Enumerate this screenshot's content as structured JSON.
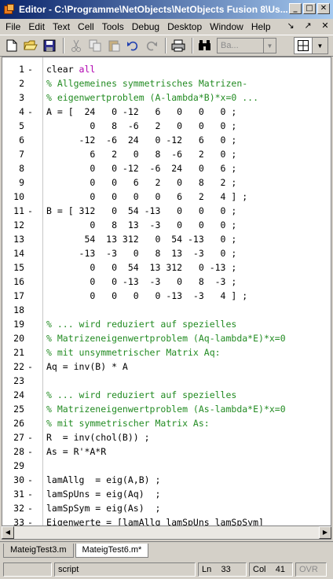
{
  "window": {
    "title": "Editor - C:\\Programme\\NetObjects\\NetObjects Fusion 8\\Us...",
    "buttons": [
      "_",
      "□",
      "✕"
    ]
  },
  "menu": {
    "items": [
      "File",
      "Edit",
      "Text",
      "Cell",
      "Tools",
      "Debug",
      "Desktop",
      "Window",
      "Help"
    ],
    "right_icons": [
      "↘",
      "↗",
      "✕"
    ]
  },
  "toolbar": {
    "combo_value": "Ba...",
    "icons": [
      "new-file-icon",
      "open-folder-icon",
      "save-icon",
      "cut-icon",
      "copy-icon",
      "paste-icon",
      "undo-icon",
      "redo-icon",
      "print-icon",
      "find-icon"
    ]
  },
  "editor": {
    "lines": [
      {
        "n": "1",
        "dash": "-",
        "segments": [
          {
            "t": "clear ",
            "c": ""
          },
          {
            "t": "all",
            "c": "kw"
          }
        ]
      },
      {
        "n": "2",
        "dash": "",
        "segments": [
          {
            "t": "% Allgemeines symmetrisches Matrizen-",
            "c": "cm"
          }
        ]
      },
      {
        "n": "3",
        "dash": "",
        "segments": [
          {
            "t": "% eigenwertproblem (A-lambda*B)*x=0 ...",
            "c": "cm"
          }
        ]
      },
      {
        "n": "4",
        "dash": "-",
        "segments": [
          {
            "t": "A = [  24   0 -12   6   0   0   0 ;",
            "c": ""
          }
        ]
      },
      {
        "n": "5",
        "dash": "",
        "segments": [
          {
            "t": "        0   8  -6   2   0   0   0 ;",
            "c": ""
          }
        ]
      },
      {
        "n": "6",
        "dash": "",
        "segments": [
          {
            "t": "      -12  -6  24   0 -12   6   0 ;",
            "c": ""
          }
        ]
      },
      {
        "n": "7",
        "dash": "",
        "segments": [
          {
            "t": "        6   2   0   8  -6   2   0 ;",
            "c": ""
          }
        ]
      },
      {
        "n": "8",
        "dash": "",
        "segments": [
          {
            "t": "        0   0 -12  -6  24   0   6 ;",
            "c": ""
          }
        ]
      },
      {
        "n": "9",
        "dash": "",
        "segments": [
          {
            "t": "        0   0   6   2   0   8   2 ;",
            "c": ""
          }
        ]
      },
      {
        "n": "10",
        "dash": "",
        "segments": [
          {
            "t": "        0   0   0   0   6   2   4 ] ;",
            "c": ""
          }
        ]
      },
      {
        "n": "11",
        "dash": "-",
        "segments": [
          {
            "t": "B = [ 312   0  54 -13   0   0   0 ;",
            "c": ""
          }
        ]
      },
      {
        "n": "12",
        "dash": "",
        "segments": [
          {
            "t": "        0   8  13  -3   0   0   0 ;",
            "c": ""
          }
        ]
      },
      {
        "n": "13",
        "dash": "",
        "segments": [
          {
            "t": "       54  13 312   0  54 -13   0 ;",
            "c": ""
          }
        ]
      },
      {
        "n": "14",
        "dash": "",
        "segments": [
          {
            "t": "      -13  -3   0   8  13  -3   0 ;",
            "c": ""
          }
        ]
      },
      {
        "n": "15",
        "dash": "",
        "segments": [
          {
            "t": "        0   0  54  13 312   0 -13 ;",
            "c": ""
          }
        ]
      },
      {
        "n": "16",
        "dash": "",
        "segments": [
          {
            "t": "        0   0 -13  -3   0   8  -3 ;",
            "c": ""
          }
        ]
      },
      {
        "n": "17",
        "dash": "",
        "segments": [
          {
            "t": "        0   0   0   0 -13  -3   4 ] ;",
            "c": ""
          }
        ]
      },
      {
        "n": "18",
        "dash": "",
        "segments": [
          {
            "t": "",
            "c": ""
          }
        ]
      },
      {
        "n": "19",
        "dash": "",
        "segments": [
          {
            "t": "% ... wird reduziert auf spezielles",
            "c": "cm"
          }
        ]
      },
      {
        "n": "20",
        "dash": "",
        "segments": [
          {
            "t": "% Matrizeneigenwertproblem (Aq-lambda*E)*x=0",
            "c": "cm"
          }
        ]
      },
      {
        "n": "21",
        "dash": "",
        "segments": [
          {
            "t": "% mit unsymmetrischer Matrix Aq:",
            "c": "cm"
          }
        ]
      },
      {
        "n": "22",
        "dash": "-",
        "segments": [
          {
            "t": "Aq = inv(B) * A",
            "c": ""
          }
        ]
      },
      {
        "n": "23",
        "dash": "",
        "segments": [
          {
            "t": "",
            "c": ""
          }
        ]
      },
      {
        "n": "24",
        "dash": "",
        "segments": [
          {
            "t": "% ... wird reduziert auf spezielles",
            "c": "cm"
          }
        ]
      },
      {
        "n": "25",
        "dash": "",
        "segments": [
          {
            "t": "% Matrizeneigenwertproblem (As-lambda*E)*x=0",
            "c": "cm"
          }
        ]
      },
      {
        "n": "26",
        "dash": "",
        "segments": [
          {
            "t": "% mit symmetrischer Matrix As:",
            "c": "cm"
          }
        ]
      },
      {
        "n": "27",
        "dash": "-",
        "segments": [
          {
            "t": "R  = inv(chol(B)) ;",
            "c": ""
          }
        ]
      },
      {
        "n": "28",
        "dash": "-",
        "segments": [
          {
            "t": "As = R'*A*R",
            "c": ""
          }
        ]
      },
      {
        "n": "29",
        "dash": "",
        "segments": [
          {
            "t": "",
            "c": ""
          }
        ]
      },
      {
        "n": "30",
        "dash": "-",
        "segments": [
          {
            "t": "lamAllg  = eig(A,B) ;",
            "c": ""
          }
        ]
      },
      {
        "n": "31",
        "dash": "-",
        "segments": [
          {
            "t": "lamSpUns = eig(Aq)  ;",
            "c": ""
          }
        ]
      },
      {
        "n": "32",
        "dash": "-",
        "segments": [
          {
            "t": "lamSpSym = eig(As)  ;",
            "c": ""
          }
        ]
      },
      {
        "n": "33",
        "dash": "-",
        "segments": [
          {
            "t": "Eigenwerte = [lamAllg lamSpUns lamSpSym]",
            "c": ""
          }
        ]
      }
    ]
  },
  "tabs": [
    {
      "label": "MateigTest3.m",
      "active": false
    },
    {
      "label": "MateigTest6.m*",
      "active": true
    }
  ],
  "status": {
    "mode": "script",
    "ln_label": "Ln",
    "ln_value": "33",
    "col_label": "Col",
    "col_value": "41",
    "ovr": "OVR"
  }
}
